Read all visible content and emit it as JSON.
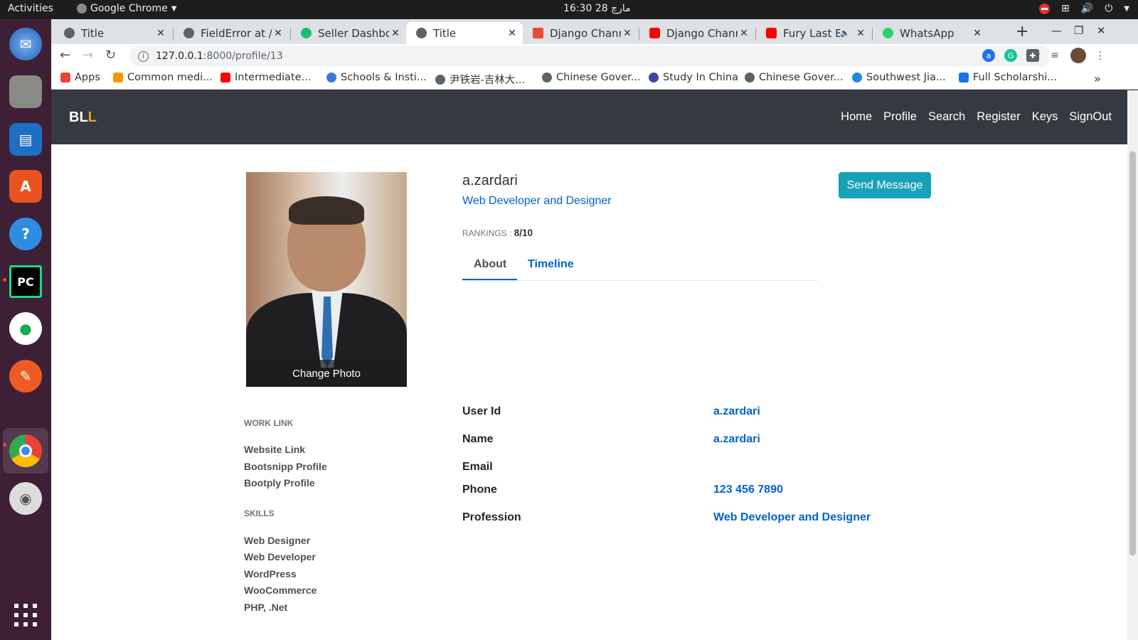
{
  "os": {
    "activities": "Activities",
    "app_menu": "Google Chrome",
    "clock": "مارچ 28  16:30"
  },
  "dock": {
    "items": [
      "thunderbird-icon",
      "files-icon",
      "writer-icon",
      "software-center-icon",
      "help-icon",
      "pycharm-icon",
      "mongodb-compass-icon",
      "postman-icon",
      "chrome-icon",
      "disc-icon"
    ],
    "pycharm_label": "PC",
    "help_label": "?",
    "software_label": "A"
  },
  "browser": {
    "tabs": [
      {
        "title": "Title",
        "favicon_color": "#5f6368"
      },
      {
        "title": "FieldError at /f",
        "favicon_color": "#5f6368"
      },
      {
        "title": "Seller Dashboa",
        "favicon_color": "#1dbf73"
      },
      {
        "title": "Title",
        "favicon_color": "#5f6368",
        "active": true
      },
      {
        "title": "Django Channe",
        "favicon_color": "#e74c3c"
      },
      {
        "title": "Django Channe",
        "favicon_color": "#ff0000"
      },
      {
        "title": "Fury Last B",
        "favicon_color": "#ff0000"
      },
      {
        "title": "WhatsApp",
        "favicon_color": "#25d366"
      }
    ],
    "url_host": "127.0.0.1",
    "url_path": ":8000/profile/13",
    "bookmarks": [
      {
        "label": "Apps",
        "color": "#ea4335"
      },
      {
        "label": "Common medi...",
        "color": "#f29900"
      },
      {
        "label": "Intermediate...",
        "color": "#ff0000"
      },
      {
        "label": "Schools & Insti...",
        "color": "#3c78d8"
      },
      {
        "label": "尹铁岩-吉林大...",
        "color": "#5f6368"
      },
      {
        "label": "Chinese Gover...",
        "color": "#5f6368"
      },
      {
        "label": "Study In China",
        "color": "#3949ab"
      },
      {
        "label": "Chinese Gover...",
        "color": "#5f6368"
      },
      {
        "label": "Southwest Jia...",
        "color": "#1e88e5"
      },
      {
        "label": "Full Scholarshi...",
        "color": "#1a73e8"
      }
    ],
    "more_bookmarks": "»"
  },
  "site": {
    "brand_main": "BL",
    "brand_accent": "L",
    "nav": [
      "Home",
      "Profile",
      "Search",
      "Register",
      "Keys",
      "SignOut"
    ]
  },
  "profile": {
    "change_photo": "Change Photo",
    "name": "a.zardari",
    "title": "Web Developer and Designer",
    "ranking_label": "RANKINGS : ",
    "ranking_value": "8/10",
    "send_message": "Send Message",
    "tabs": [
      "About",
      "Timeline"
    ],
    "work_link_heading": "WORK LINK",
    "work_links": [
      "Website Link",
      "Bootsnipp Profile",
      "Bootply Profile"
    ],
    "skills_heading": "SKILLS",
    "skills": [
      "Web Designer",
      "Web Developer",
      "WordPress",
      "WooCommerce",
      "PHP, .Net"
    ],
    "info": [
      {
        "label": "User Id",
        "value": "a.zardari"
      },
      {
        "label": "Name",
        "value": "a.zardari"
      },
      {
        "label": "Email",
        "value": ""
      },
      {
        "label": "Phone",
        "value": "123 456 7890"
      },
      {
        "label": "Profession",
        "value": "Web Developer and Designer"
      }
    ]
  }
}
